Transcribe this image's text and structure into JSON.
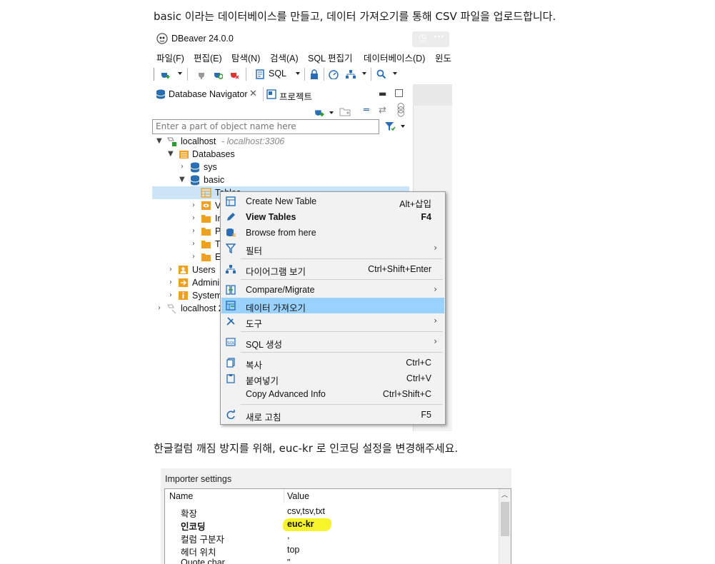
{
  "doc": {
    "para1": "basic 이라는 데이터베이스를 만들고, 데이터 가져오기를 통해 CSV 파일을 업로드합니다.",
    "para2": "한글컬럼 깨짐 방지를 위해, euc-kr 로 인코딩 설정을 변경해주세요."
  },
  "window": {
    "title": "DBeaver 24.0.0",
    "menu": [
      "파일(F)",
      "편집(E)",
      "탐색(N)",
      "검색(A)",
      "SQL 편집기",
      "데이터베이스(D)",
      "윈도"
    ],
    "toolbar_sql": "SQL"
  },
  "navigator": {
    "tab_navigator": "Database Navigator",
    "tab_project": "프로젝트",
    "filter_placeholder": "Enter a part of object name here",
    "tree": {
      "conn1": "localhost",
      "conn1_detail": "- localhost:3306",
      "databases": "Databases",
      "sys": "sys",
      "basic": "basic",
      "tables": "Tables",
      "v": "V",
      "i": "Ir",
      "p": "P",
      "t": "T",
      "e": "E",
      "users": "Users",
      "admin": "Admini",
      "system": "System",
      "conn2": "localhost 2"
    }
  },
  "context_menu": {
    "items": [
      {
        "label": "Create New Table",
        "shortcut": "Alt+삽입"
      },
      {
        "label": "View Tables",
        "shortcut": "F4"
      },
      {
        "label": "Browse from here",
        "shortcut": ""
      },
      {
        "label": "필터",
        "shortcut": ""
      },
      {
        "label": "다이어그램 보기",
        "shortcut": "Ctrl+Shift+Enter"
      },
      {
        "label": "Compare/Migrate",
        "shortcut": ""
      },
      {
        "label": "데이터 가져오기",
        "shortcut": ""
      },
      {
        "label": "도구",
        "shortcut": ""
      },
      {
        "label": "SQL 생성",
        "shortcut": ""
      },
      {
        "label": "복사",
        "shortcut": "Ctrl+C"
      },
      {
        "label": "붙여넣기",
        "shortcut": "Ctrl+V"
      },
      {
        "label": "Copy Advanced Info",
        "shortcut": "Ctrl+Shift+C"
      },
      {
        "label": "새로 고침",
        "shortcut": "F5"
      }
    ]
  },
  "importer": {
    "title": "Importer settings",
    "col_name": "Name",
    "col_value": "Value",
    "rows": [
      {
        "name": "확장",
        "value": "csv,tsv,txt"
      },
      {
        "name": "인코딩",
        "value": "euc-kr"
      },
      {
        "name": "컬럼 구분자",
        "value": ","
      },
      {
        "name": "헤더 위치",
        "value": "top"
      },
      {
        "name": "Quote char",
        "value": "\""
      }
    ]
  },
  "colors": {
    "selection": "#cce4f7",
    "menu_highlight": "#99d1ff",
    "marker_yellow": "#f7f52a",
    "db_blue": "#2a6fb4",
    "folder_orange": "#f0a020"
  }
}
